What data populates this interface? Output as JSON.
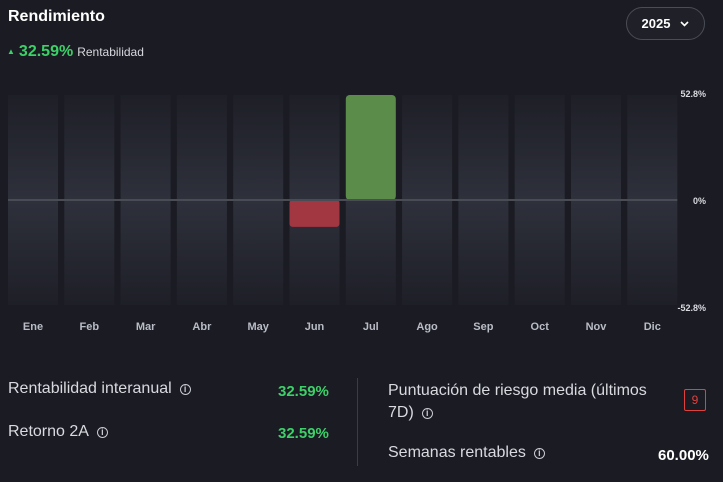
{
  "header": {
    "title": "Rendimiento",
    "performance_value": "32.59%",
    "performance_label": "Rentabilidad",
    "year_selector": "2025"
  },
  "chart_data": {
    "type": "bar",
    "categories": [
      "Ene",
      "Feb",
      "Mar",
      "Abr",
      "May",
      "Jun",
      "Jul",
      "Ago",
      "Sep",
      "Oct",
      "Nov",
      "Dic"
    ],
    "values": [
      null,
      null,
      null,
      null,
      null,
      -13.5,
      52.8,
      null,
      null,
      null,
      null,
      null
    ],
    "ylim": [
      -52.8,
      52.8
    ],
    "y_tick_labels": [
      "52.8%",
      "0%",
      "-52.8%"
    ],
    "colors": {
      "positive": "#5c8c4a",
      "negative": "#a23641",
      "track": "#2a2c36",
      "zero_line": "#4a4c55"
    }
  },
  "stats": {
    "annual_return": {
      "label": "Rentabilidad interanual",
      "value": "32.59%"
    },
    "return_2a": {
      "label": "Retorno 2A",
      "value": "32.59%"
    },
    "risk_score": {
      "label_line1": "Puntuación de riesgo media (últimos",
      "label_line2": "7D)",
      "value": "9"
    },
    "profitable_weeks": {
      "label": "Semanas rentables",
      "value": "60.00%"
    }
  },
  "icons": {
    "info": "i",
    "chevron": "chevron-down-icon",
    "up_arrow": "▲"
  }
}
